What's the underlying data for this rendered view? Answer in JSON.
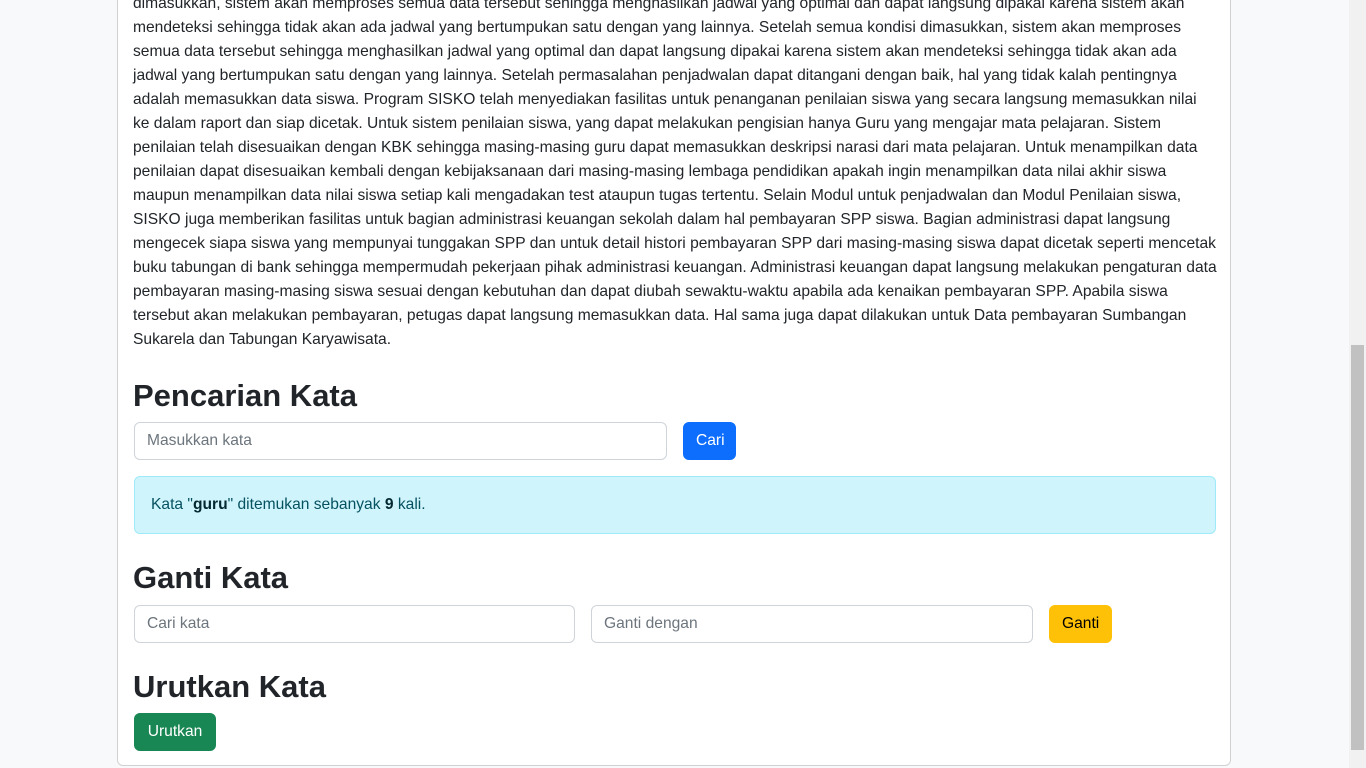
{
  "article": {
    "text": "dimasukkan, sistem akan memproses semua data tersebut sehingga menghasilkan jadwal yang optimal dan dapat langsung dipakai karena sistem akan mendeteksi sehingga tidak akan ada jadwal yang bertumpukan satu dengan yang lainnya. Setelah semua kondisi dimasukkan, sistem akan memproses semua data tersebut sehingga menghasilkan jadwal yang optimal dan dapat langsung dipakai karena sistem akan mendeteksi sehingga tidak akan ada jadwal yang bertumpukan satu dengan yang lainnya. Setelah permasalahan penjadwalan dapat ditangani dengan baik, hal yang tidak kalah pentingnya adalah memasukkan data siswa. Program SISKO telah menyediakan fasilitas untuk penanganan penilaian siswa yang secara langsung memasukkan nilai ke dalam raport dan siap dicetak. Untuk sistem penilaian siswa, yang dapat melakukan pengisian hanya Guru yang mengajar mata pelajaran. Sistem penilaian telah disesuaikan dengan KBK sehingga masing-masing guru dapat memasukkan deskripsi narasi dari mata pelajaran. Untuk menampilkan data penilaian dapat disesuaikan kembali dengan kebijaksanaan dari masing-masing lembaga pendidikan apakah ingin menampilkan data nilai akhir siswa maupun menampilkan data nilai siswa setiap kali mengadakan test ataupun tugas tertentu. Selain Modul untuk penjadwalan dan Modul Penilaian siswa, SISKO juga memberikan fasilitas untuk bagian administrasi keuangan sekolah dalam hal pembayaran SPP siswa. Bagian administrasi dapat langsung mengecek siapa siswa yang mempunyai tunggakan SPP dan untuk detail histori pembayaran SPP dari masing-masing siswa dapat dicetak seperti mencetak buku tabungan di bank sehingga mempermudah pekerjaan pihak administrasi keuangan. Administrasi keuangan dapat langsung melakukan pengaturan data pembayaran masing-masing siswa sesuai dengan kebutuhan dan dapat diubah sewaktu-waktu apabila ada kenaikan pembayaran SPP. Apabila siswa tersebut akan melakukan pembayaran, petugas dapat langsung memasukkan data. Hal sama juga dapat dilakukan untuk Data pembayaran Sumbangan Sukarela dan Tabungan Karyawisata."
  },
  "search": {
    "heading": "Pencarian Kata",
    "placeholder": "Masukkan kata",
    "button_label": "Cari",
    "result": {
      "prefix": "Kata \"",
      "word": "guru",
      "middle": "\" ditemukan sebanyak ",
      "count": "9",
      "suffix": " kali."
    }
  },
  "replace": {
    "heading": "Ganti Kata",
    "find_placeholder": "Cari kata",
    "replace_placeholder": "Ganti dengan",
    "button_label": "Ganti"
  },
  "sort": {
    "heading": "Urutkan Kata",
    "button_label": "Urutkan"
  },
  "colors": {
    "primary": "#0d6efd",
    "warning": "#ffc107",
    "success": "#198754",
    "info_bg": "#cff4fc"
  }
}
